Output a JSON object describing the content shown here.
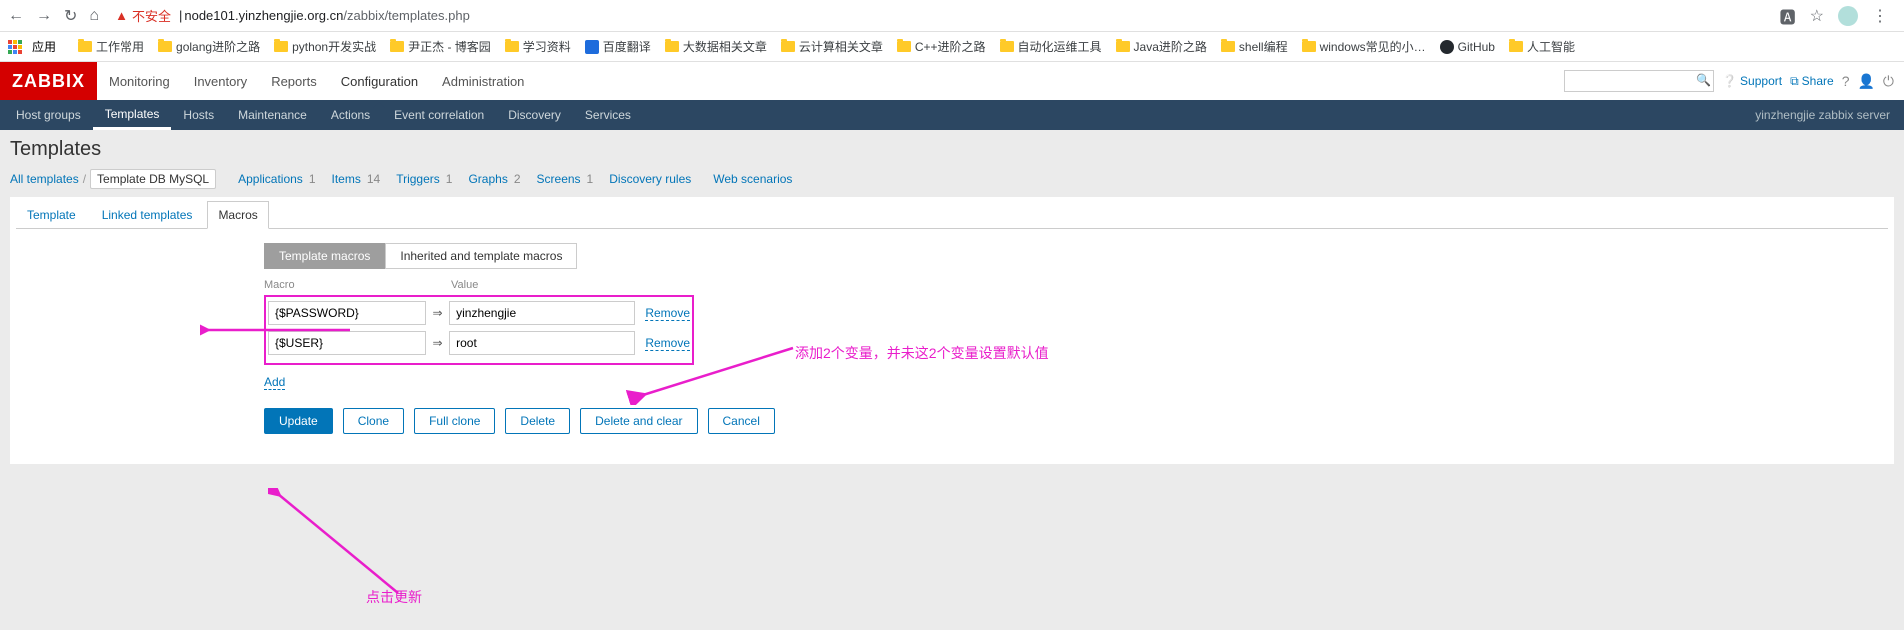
{
  "browser": {
    "secure_label": "不安全",
    "url_host": "node101.yinzhengjie.org.cn",
    "url_path": "/zabbix/templates.php",
    "bookmarks_apps": "应用",
    "bookmarks": [
      "工作常用",
      "golang进阶之路",
      "python开发实战",
      "尹正杰 - 博客园",
      "学习资料",
      "百度翻译",
      "大数据相关文章",
      "云计算相关文章",
      "C++进阶之路",
      "自动化运维工具",
      "Java进阶之路",
      "shell编程",
      "windows常见的小…",
      "GitHub",
      "人工智能"
    ]
  },
  "header": {
    "logo": "ZABBIX",
    "nav": [
      "Monitoring",
      "Inventory",
      "Reports",
      "Configuration",
      "Administration"
    ],
    "active_nav": "Configuration",
    "support": "Support",
    "share": "Share"
  },
  "subnav": {
    "items": [
      "Host groups",
      "Templates",
      "Hosts",
      "Maintenance",
      "Actions",
      "Event correlation",
      "Discovery",
      "Services"
    ],
    "active": "Templates",
    "server": "yinzhengjie zabbix server"
  },
  "page": {
    "title": "Templates",
    "crumb_all": "All templates",
    "crumb_current": "Template DB MySQL",
    "links": [
      {
        "label": "Applications",
        "count": "1"
      },
      {
        "label": "Items",
        "count": "14"
      },
      {
        "label": "Triggers",
        "count": "1"
      },
      {
        "label": "Graphs",
        "count": "2"
      },
      {
        "label": "Screens",
        "count": "1"
      },
      {
        "label": "Discovery rules",
        "count": ""
      },
      {
        "label": "Web scenarios",
        "count": ""
      }
    ]
  },
  "tabs": [
    "Template",
    "Linked templates",
    "Macros"
  ],
  "active_tab": "Macros",
  "toggle": {
    "template": "Template macros",
    "inherited": "Inherited and template macros"
  },
  "table": {
    "col_macro": "Macro",
    "col_value": "Value",
    "rows": [
      {
        "macro": "{$PASSWORD}",
        "value": "yinzhengjie"
      },
      {
        "macro": "{$USER}",
        "value": "root"
      }
    ],
    "remove": "Remove",
    "add": "Add"
  },
  "buttons": {
    "update": "Update",
    "clone": "Clone",
    "full_clone": "Full clone",
    "delete": "Delete",
    "delete_clear": "Delete and clear",
    "cancel": "Cancel"
  },
  "annotation": {
    "text1": "添加2个变量，并未这2个变量设置默认值",
    "text2": "点击更新"
  }
}
